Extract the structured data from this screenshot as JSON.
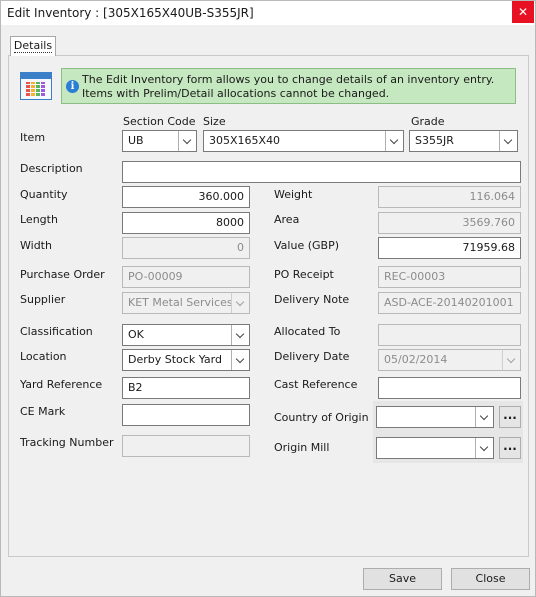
{
  "window": {
    "title": "Edit Inventory : [305X165X40UB-S355JR]",
    "close_glyph": "✕"
  },
  "tabs": [
    {
      "label": "Details"
    }
  ],
  "info": {
    "text": "The Edit Inventory form allows you to change details of an inventory entry. Items with Prelim/Detail allocations cannot be changed.",
    "icon_glyph": "i"
  },
  "colors": {
    "info_bg": "#c6e8c0",
    "close_bg": "#e81123",
    "icon_blue": "#2a7fd4"
  },
  "labels": {
    "item": "Item",
    "section_code": "Section Code",
    "size": "Size",
    "grade": "Grade",
    "description": "Description",
    "quantity": "Quantity",
    "length": "Length",
    "width": "Width",
    "weight": "Weight",
    "area": "Area",
    "value": "Value (GBP)",
    "purchase_order": "Purchase Order",
    "po_receipt": "PO Receipt",
    "supplier": "Supplier",
    "delivery_note": "Delivery Note",
    "classification": "Classification",
    "allocated_to": "Allocated To",
    "location": "Location",
    "delivery_date": "Delivery Date",
    "yard_reference": "Yard Reference",
    "cast_reference": "Cast Reference",
    "ce_mark": "CE Mark",
    "country_of_origin": "Country of Origin",
    "tracking_number": "Tracking Number",
    "origin_mill": "Origin Mill"
  },
  "fields": {
    "section_code": "UB",
    "size": "305X165X40",
    "grade": "S355JR",
    "description": "",
    "quantity": "360.000",
    "length": "8000",
    "width": "0",
    "weight": "116.064",
    "area": "3569.760",
    "value": "71959.68",
    "purchase_order": "PO-00009",
    "po_receipt": "REC-00003",
    "supplier": "KET Metal Services",
    "delivery_note": "ASD-ACE-20140201001",
    "classification": "OK",
    "allocated_to": "",
    "location": "Derby Stock Yard",
    "delivery_date": "05/02/2014",
    "yard_reference": "B2",
    "cast_reference": "",
    "ce_mark": "",
    "country_of_origin": "",
    "tracking_number": "",
    "origin_mill": ""
  },
  "buttons": {
    "ellipsis": "...",
    "save": "Save",
    "close": "Close"
  },
  "icons": {
    "form": "inventory-form-icon",
    "info": "info-icon",
    "dropdown": "chevron-down-icon"
  }
}
